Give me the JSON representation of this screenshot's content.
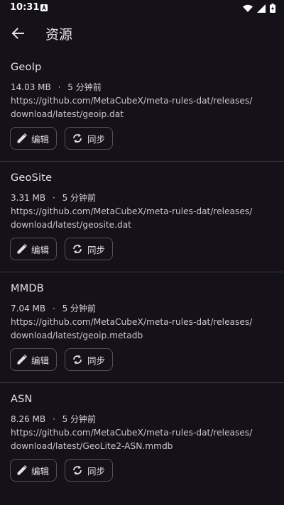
{
  "status_bar": {
    "time": "10:31",
    "icons": [
      "notification-a-icon",
      "wifi-icon",
      "signal-icon",
      "battery-charging-icon"
    ]
  },
  "app_bar": {
    "title": "资源",
    "back_icon": "arrow-left-icon"
  },
  "buttons": {
    "edit_label": "编辑",
    "edit_icon": "pencil-icon",
    "sync_label": "同步",
    "sync_icon": "sync-icon"
  },
  "resources": [
    {
      "name": "GeoIp",
      "size": "14.03 MB",
      "separator": "·",
      "updated": "5 分钟前",
      "url_line1": "https://github.com/MetaCubeX/meta-rules-dat/releases/",
      "url_line2": "download/latest/geoip.dat"
    },
    {
      "name": "GeoSite",
      "size": "3.31 MB",
      "separator": "·",
      "updated": "5 分钟前",
      "url_line1": "https://github.com/MetaCubeX/meta-rules-dat/releases/",
      "url_line2": "download/latest/geosite.dat"
    },
    {
      "name": "MMDB",
      "size": "7.04 MB",
      "separator": "·",
      "updated": "5 分钟前",
      "url_line1": "https://github.com/MetaCubeX/meta-rules-dat/releases/",
      "url_line2": "download/latest/geoip.metadb"
    },
    {
      "name": "ASN",
      "size": "8.26 MB",
      "separator": "·",
      "updated": "5 分钟前",
      "url_line1": "https://github.com/MetaCubeX/meta-rules-dat/releases/",
      "url_line2": "download/latest/GeoLite2-ASN.mmdb"
    }
  ],
  "colors": {
    "background": "#141218",
    "text": "#e6e0e9",
    "outline": "#55505c",
    "divider": "#3a3640"
  }
}
